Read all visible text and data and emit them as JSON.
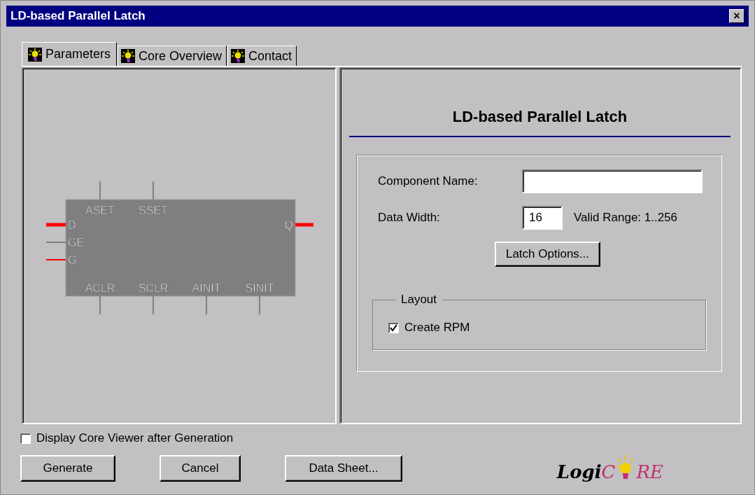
{
  "window": {
    "title": "LD-based Parallel Latch",
    "close": "×"
  },
  "tabs": [
    {
      "label": "Parameters",
      "selected": true
    },
    {
      "label": "Core Overview",
      "selected": false
    },
    {
      "label": "Contact",
      "selected": false
    }
  ],
  "symbol": {
    "left_pins": [
      {
        "label": "D",
        "kind": "bus",
        "color": "#ff0000"
      },
      {
        "label": "GE",
        "kind": "wire",
        "color": "#808080"
      },
      {
        "label": "G",
        "kind": "wire",
        "color": "#ff0000"
      }
    ],
    "right_pins": [
      {
        "label": "Q",
        "kind": "bus",
        "color": "#ff0000"
      }
    ],
    "top_pins": [
      {
        "label": "ASET",
        "kind": "wire",
        "color": "#808080"
      },
      {
        "label": "SSET",
        "kind": "wire",
        "color": "#808080"
      }
    ],
    "bottom_pins": [
      {
        "label": "ACLR",
        "kind": "wire",
        "color": "#808080"
      },
      {
        "label": "SCLR",
        "kind": "wire",
        "color": "#808080"
      },
      {
        "label": "AINIT",
        "kind": "wire",
        "color": "#808080"
      },
      {
        "label": "SINIT",
        "kind": "wire",
        "color": "#808080"
      }
    ]
  },
  "parameters": {
    "heading": "LD-based Parallel Latch",
    "component_name": {
      "label": "Component Name:"
    },
    "data_width": {
      "label": "Data Width:",
      "value": "16",
      "hint": "Valid Range: 1..256"
    },
    "options_button": "Latch Options...",
    "layout": {
      "legend": "Layout",
      "create_rpm": {
        "label": "Create RPM",
        "checked": true
      }
    }
  },
  "display_viewer": {
    "label": "Display Core Viewer after Generation",
    "checked": false
  },
  "buttons": [
    "Generate",
    "Cancel",
    "Data Sheet..."
  ],
  "logo": {
    "parts": [
      "Logi",
      "C",
      "RE"
    ]
  }
}
